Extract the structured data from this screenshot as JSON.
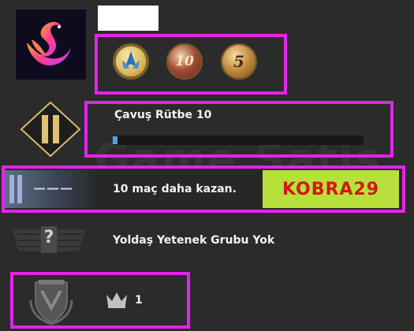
{
  "watermark": "Game Satis",
  "profile": {
    "avatar_icon": "pink-swan-icon",
    "name": ""
  },
  "medals": [
    {
      "icon": "blue-winged-medal-icon",
      "label": ""
    },
    {
      "icon": "service-medal-10-icon",
      "label": "10"
    },
    {
      "icon": "service-medal-5-icon",
      "label": "5"
    }
  ],
  "rank": {
    "icon": "rank-diamond-chevron-icon",
    "title": "Çavuş Rütbe 10",
    "progress": 0.02,
    "bar_color": "#4ea4d9"
  },
  "wins": {
    "icon": "competitive-rank-stripe-icon",
    "strip_text": "———",
    "text": "10 maç daha kazan.",
    "overlay_label": "KOBRA29",
    "overlay_bg": "#b8e03a",
    "overlay_fg": "#d21818"
  },
  "skill_group": {
    "icon": "unknown-skill-group-icon",
    "question_mark": "?",
    "text": "Yoldaş Yetenek Grubu Yok"
  },
  "bottom": {
    "icon": "shield-wreath-icon",
    "crown_icon": "crown-icon",
    "count": "1"
  },
  "colors": {
    "background": "#2b2b2b",
    "highlight": "#e225e6"
  }
}
